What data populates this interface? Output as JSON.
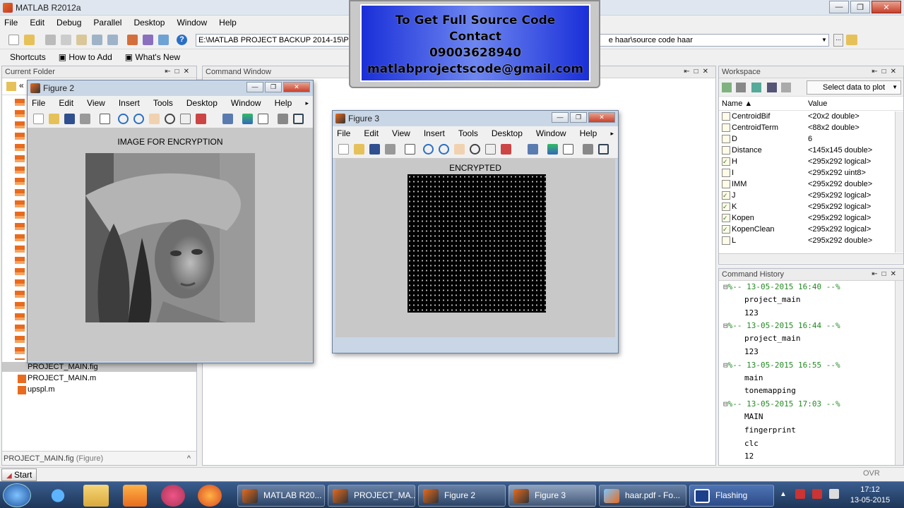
{
  "window": {
    "title": "MATLAB  R2012a",
    "min": "—",
    "max": "❐",
    "close": "✕"
  },
  "menu": [
    "File",
    "Edit",
    "Debug",
    "Parallel",
    "Desktop",
    "Window",
    "Help"
  ],
  "toolbar": {
    "path_left": "E:\\MATLAB PROJECT BACKUP 2014-15\\PR",
    "path_right": "e haar\\source code haar",
    "help_icon": "?"
  },
  "shortcuts": {
    "shortcuts": "Shortcuts",
    "how_to_add": "How to Add",
    "whats_new": "What's New"
  },
  "current_folder": {
    "header": "Current Folder",
    "back": "«",
    "files": [
      "PROJECT_MAIN.fig",
      "PROJECT_MAIN.m",
      "upspl.m"
    ],
    "footer": "PROJECT_MAIN.fig",
    "footer_suffix": "(Figure)",
    "collapse": "^"
  },
  "command_window": {
    "header": "Command Window"
  },
  "figure2": {
    "title": "Figure 2",
    "menu": [
      "File",
      "Edit",
      "View",
      "Insert",
      "Tools",
      "Desktop",
      "Window",
      "Help"
    ],
    "caption": "IMAGE FOR ENCRYPTION"
  },
  "figure3": {
    "title": "Figure 3",
    "menu": [
      "File",
      "Edit",
      "View",
      "Insert",
      "Tools",
      "Desktop",
      "Window",
      "Help"
    ],
    "caption": "ENCRYPTED"
  },
  "banner": {
    "line1": "To Get Full Source Code",
    "line2": "Contact",
    "line3": "09003628940",
    "line4": "matlabprojectscode@gmail.com"
  },
  "workspace": {
    "header": "Workspace",
    "select_data": "Select data to plot",
    "col_name": "Name ▲",
    "col_value": "Value",
    "rows": [
      {
        "name": "CentroidBif",
        "value": "<20x2 double>"
      },
      {
        "name": "CentroidTerm",
        "value": "<88x2 double>"
      },
      {
        "name": "D",
        "value": "6"
      },
      {
        "name": "Distance",
        "value": "<145x145 double>"
      },
      {
        "name": "H",
        "value": "<295x292 logical>"
      },
      {
        "name": "I",
        "value": "<295x292 uint8>"
      },
      {
        "name": "IMM",
        "value": "<295x292 double>"
      },
      {
        "name": "J",
        "value": "<295x292 logical>"
      },
      {
        "name": "K",
        "value": "<295x292 logical>"
      },
      {
        "name": "Kopen",
        "value": "<295x292 logical>"
      },
      {
        "name": "KopenClean",
        "value": "<295x292 logical>"
      },
      {
        "name": "L",
        "value": "<295x292 double>"
      }
    ]
  },
  "history": {
    "header": "Command History",
    "entries": [
      {
        "date": "%-- 13-05-2015 16:40 --%",
        "cmds": [
          "project_main",
          "123"
        ]
      },
      {
        "date": "%-- 13-05-2015 16:44 --%",
        "cmds": [
          "project_main",
          "123"
        ]
      },
      {
        "date": "%-- 13-05-2015 16:55 --%",
        "cmds": [
          "main",
          "tonemapping"
        ]
      },
      {
        "date": "%-- 13-05-2015 17:03 --%",
        "cmds": [
          "MAIN",
          "fingerprint",
          "clc",
          "12"
        ]
      }
    ]
  },
  "statusbar": {
    "start": "Start",
    "ovr": "OVR"
  },
  "taskbar": {
    "buttons": [
      "MATLAB  R20...",
      "PROJECT_MA...",
      "Figure 2",
      "Figure 3",
      "haar.pdf - Fo...",
      "Flashing"
    ],
    "time": "17:12",
    "date": "13-05-2015"
  }
}
